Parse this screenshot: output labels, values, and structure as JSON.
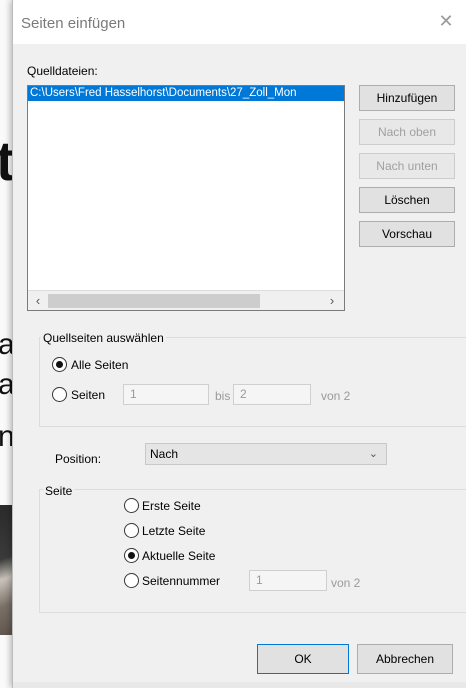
{
  "dialog": {
    "title": "Seiten einfügen",
    "close_glyph": "✕"
  },
  "background_doc": {
    "glyphs": [
      "t",
      "a",
      "a",
      "n"
    ]
  },
  "source_files": {
    "label": "Quelldateien:",
    "items": [
      "C:\\Users\\Fred Hasselhorst\\Documents\\27_Zoll_Mon"
    ],
    "scroll_left_glyph": "‹",
    "scroll_right_glyph": "›"
  },
  "side_buttons": {
    "add": "Hinzufügen",
    "up": "Nach oben",
    "down": "Nach unten",
    "delete": "Löschen",
    "preview": "Vorschau"
  },
  "source_pages": {
    "group_label": "Quellseiten auswählen",
    "all_label": "Alle Seiten",
    "pages_label": "Seiten",
    "from_value": "1",
    "to_label": "bis",
    "to_value": "2",
    "of_label": "von 2",
    "selected": "all"
  },
  "position": {
    "label": "Position:",
    "value": "Nach"
  },
  "page": {
    "group_label": "Seite",
    "first": "Erste Seite",
    "last": "Letzte Seite",
    "current": "Aktuelle Seite",
    "number": "Seitennummer",
    "number_value": "1",
    "of_label": "von 2",
    "selected": "current"
  },
  "footer": {
    "ok": "OK",
    "cancel": "Abbrechen"
  },
  "colors": {
    "selection": "#0078d7",
    "dialog_bg": "#f0f0f0",
    "button_bg": "#e1e1e1"
  },
  "icons": {
    "close": "close-icon",
    "chevron": "chevron-down-icon"
  }
}
